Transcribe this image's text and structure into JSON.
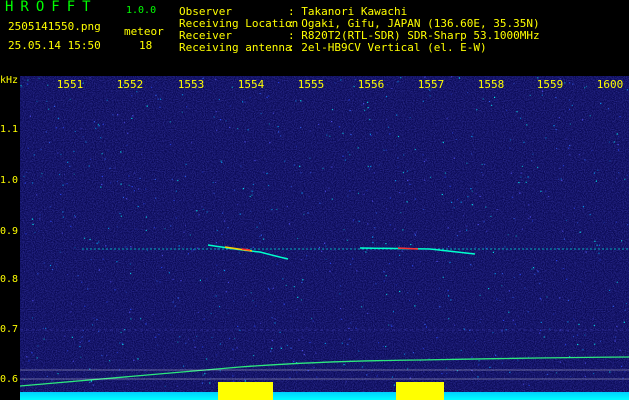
{
  "app": {
    "name": "HROFFT",
    "version": "1.0.0"
  },
  "file": {
    "name": "2505141550.png",
    "datetime": "25.05.14 15:50"
  },
  "mode": {
    "label": "meteor",
    "count": "18"
  },
  "info": {
    "observer_label": "Observer",
    "observer_value": ": Takanori Kawachi",
    "location_label": "Receiving Location",
    "location_value": ": Ogaki, Gifu, JAPAN (136.60E, 35.35N)",
    "receiver_label": "Receiver",
    "receiver_value": ": R820T2(RTL-SDR) SDR-Sharp 53.1000MHz",
    "antenna_label": "Receiving antenna",
    "antenna_value": ": 2el-HB9CV Vertical (el. E-W)"
  },
  "axis": {
    "unit": "kHz",
    "time_ticks": [
      "1551",
      "1552",
      "1553",
      "1554",
      "1555",
      "1556",
      "1557",
      "1558",
      "1559",
      "1600"
    ],
    "freq_ticks": [
      "1.1",
      "1.0",
      "0.9",
      "0.8",
      "0.7",
      "0.6"
    ]
  },
  "colors": {
    "background": "#0a0a55",
    "label": "#ffff00",
    "title": "#00ff00",
    "signal_weak": "#00ffff",
    "signal_strong": "#ff3030"
  }
}
